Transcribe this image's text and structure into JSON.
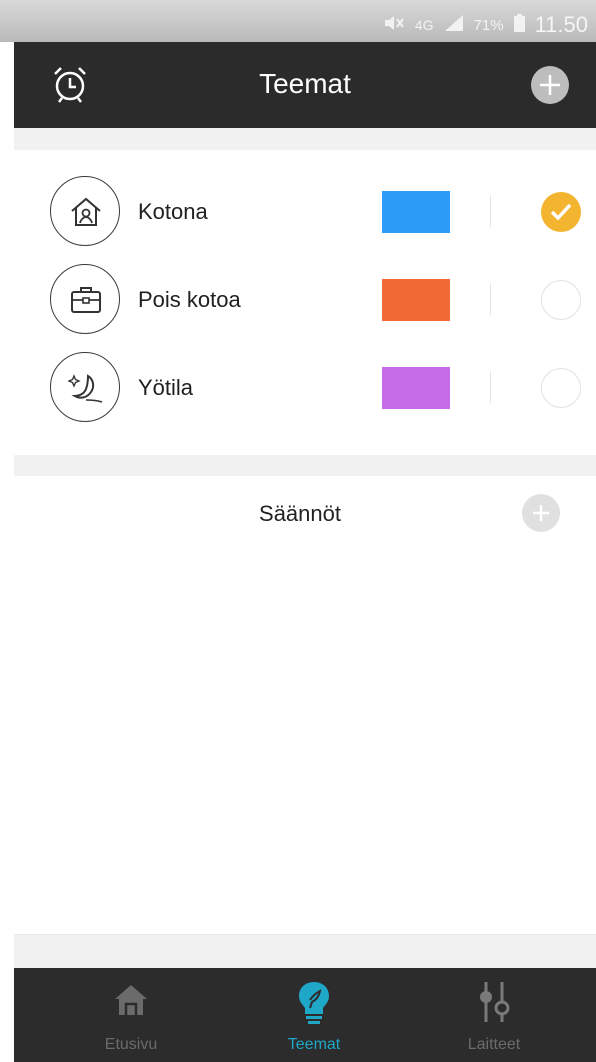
{
  "status_bar": {
    "network": "4G",
    "battery": "71%",
    "time": "11.50"
  },
  "header": {
    "title": "Teemat",
    "left_icon": "alarm-clock-icon",
    "right_icon": "plus-icon"
  },
  "themes": [
    {
      "label": "Kotona",
      "icon": "home-icon",
      "color": "#2b9bf5",
      "selected": true
    },
    {
      "label": "Pois kotoa",
      "icon": "briefcase-icon",
      "color": "#f26a35",
      "selected": false
    },
    {
      "label": "Yötila",
      "icon": "moon-icon",
      "color": "#c56be8",
      "selected": false
    }
  ],
  "rules": {
    "label": "Säännöt",
    "add_icon": "plus-icon"
  },
  "tabs": [
    {
      "label": "Etusivu",
      "icon": "house-icon",
      "active": false
    },
    {
      "label": "Teemat",
      "icon": "lightbulb-icon",
      "active": true
    },
    {
      "label": "Laitteet",
      "icon": "sliders-icon",
      "active": false
    }
  ],
  "colors": {
    "accent_active_tab": "#1fa7c8",
    "selected_check": "#f3b52f",
    "app_bar": "#2b2b2b"
  }
}
